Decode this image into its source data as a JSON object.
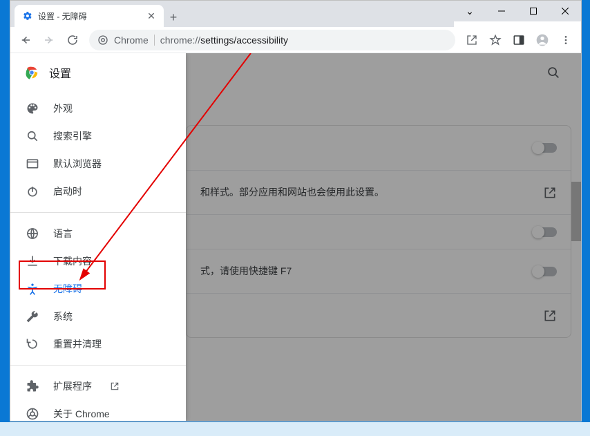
{
  "tab": {
    "title": "设置 - 无障碍"
  },
  "omnibox": {
    "scheme_label": "Chrome",
    "url_prefix": "chrome://",
    "url_path": "settings/accessibility"
  },
  "sidebar": {
    "title": "设置",
    "items": [
      {
        "label": "外观",
        "icon": "palette"
      },
      {
        "label": "搜索引擎",
        "icon": "search"
      },
      {
        "label": "默认浏览器",
        "icon": "browser"
      },
      {
        "label": "启动时",
        "icon": "power"
      }
    ],
    "items2": [
      {
        "label": "语言",
        "icon": "globe"
      },
      {
        "label": "下载内容",
        "icon": "download"
      },
      {
        "label": "无障碍",
        "icon": "accessibility",
        "active": true
      },
      {
        "label": "系统",
        "icon": "wrench"
      },
      {
        "label": "重置并清理",
        "icon": "restore"
      }
    ],
    "footer": [
      {
        "label": "扩展程序",
        "icon": "extension",
        "external": true
      },
      {
        "label": "关于 Chrome",
        "icon": "chrome"
      }
    ]
  },
  "main": {
    "rows": [
      {
        "text": "",
        "control": "toggle"
      },
      {
        "text": "和样式。部分应用和网站也会使用此设置。",
        "control": "external"
      },
      {
        "text": "",
        "control": "toggle"
      },
      {
        "text": "式，请使用快捷键 F7",
        "control": "toggle"
      },
      {
        "text": "",
        "control": "external"
      }
    ]
  }
}
